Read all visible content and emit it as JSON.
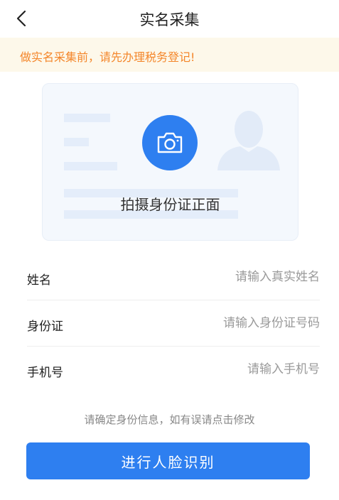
{
  "header": {
    "title": "实名采集",
    "back_icon": "chevron-left-icon"
  },
  "notice": {
    "text": "做实名采集前，请先办理税务登记!"
  },
  "id_card": {
    "caption": "拍摄身份证正面",
    "camera_icon": "camera-icon"
  },
  "form": {
    "fields": [
      {
        "label": "姓名",
        "placeholder": "请输入真实姓名",
        "value": ""
      },
      {
        "label": "身份证",
        "placeholder": "请输入身份证号码",
        "value": ""
      },
      {
        "label": "手机号",
        "placeholder": "请输入手机号",
        "value": ""
      }
    ]
  },
  "hint": "请确定身份信息，如有误请点击修改",
  "submit": {
    "label": "进行人脸识别"
  },
  "colors": {
    "accent": "#2e7ff0",
    "warning_text": "#f4862a",
    "warning_bg": "#fdf8ea"
  }
}
